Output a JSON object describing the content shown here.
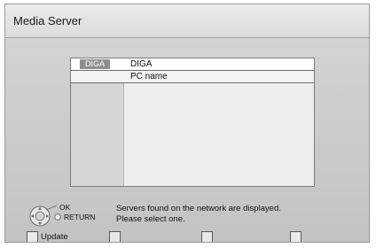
{
  "window": {
    "title": "Media Server"
  },
  "server_list": {
    "rows": [
      {
        "logo": "DIGA",
        "name": "DIGA"
      },
      {
        "name": "PC name"
      }
    ]
  },
  "remote_hint": {
    "ok": "OK",
    "return": "RETURN"
  },
  "message": {
    "line1": "Servers found on the network are displayed.",
    "line2": "Please select one."
  },
  "footer": {
    "update_label": "Update"
  },
  "colors": {
    "background": "#cccccc",
    "row_divider": "#6e6e6e",
    "logo_bg": "#8f8f8f"
  }
}
